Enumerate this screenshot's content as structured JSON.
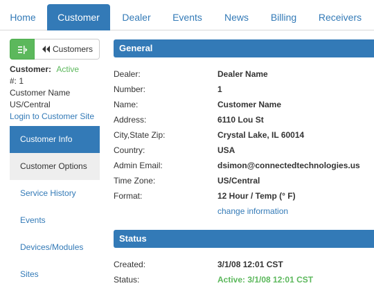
{
  "nav": {
    "tabs": [
      {
        "label": "Home"
      },
      {
        "label": "Customer"
      },
      {
        "label": "Dealer"
      },
      {
        "label": "Events"
      },
      {
        "label": "News"
      },
      {
        "label": "Billing"
      },
      {
        "label": "Receivers"
      }
    ],
    "active": "Customer"
  },
  "sidebar": {
    "back_button_label": "Customers",
    "customer_label": "Customer:",
    "customer_status": "Active",
    "number_line": "#: 1",
    "name_line": "Customer Name",
    "timezone_line": "US/Central",
    "login_link": "Login to Customer Site",
    "menu": [
      {
        "label": "Customer Info"
      },
      {
        "label": "Customer Options"
      },
      {
        "label": "Service History"
      },
      {
        "label": "Events"
      },
      {
        "label": "Devices/Modules"
      },
      {
        "label": "Sites"
      }
    ]
  },
  "general": {
    "title": "General",
    "rows": [
      {
        "label": "Dealer:",
        "value": "Dealer Name"
      },
      {
        "label": "Number:",
        "value": "1"
      },
      {
        "label": "Name:",
        "value": "Customer Name"
      },
      {
        "label": "Address:",
        "value": "6110 Lou St"
      },
      {
        "label": "City,State Zip:",
        "value": "Crystal Lake, IL 60014"
      },
      {
        "label": "Country:",
        "value": "USA"
      },
      {
        "label": "Admin Email:",
        "value": "dsimon@connectedtechnologies.us"
      },
      {
        "label": "Time Zone:",
        "value": "US/Central"
      },
      {
        "label": "Format:",
        "value": "12 Hour / Temp (° F)"
      }
    ],
    "change_link": "change information"
  },
  "status": {
    "title": "Status",
    "rows": [
      {
        "label": "Created:",
        "value": "3/1/08 12:01 CST"
      },
      {
        "label": "Status:",
        "value": "Active: 3/1/08 12:01 CST"
      }
    ]
  },
  "colors": {
    "primary": "#337ab7",
    "success": "#5cb85c"
  }
}
